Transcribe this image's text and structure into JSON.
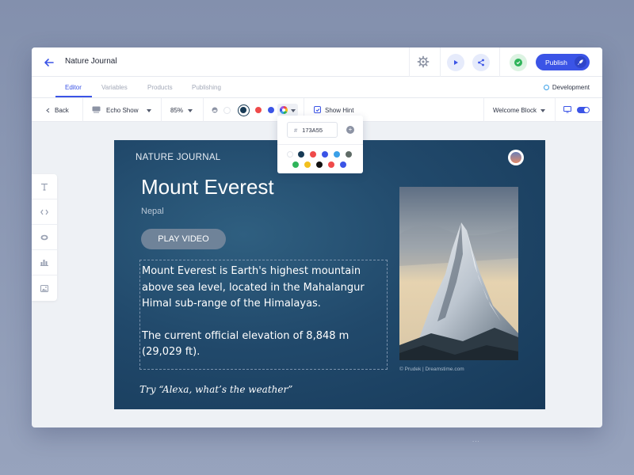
{
  "app": {
    "title": "Nature Journal"
  },
  "topbar": {
    "publish_label": "Publish"
  },
  "tabs": [
    {
      "label": "Editor",
      "active": true
    },
    {
      "label": "Variables",
      "active": false
    },
    {
      "label": "Products",
      "active": false
    },
    {
      "label": "Publishing",
      "active": false
    }
  ],
  "environment": {
    "label": "Development"
  },
  "toolbar": {
    "back_label": "Back",
    "device": "Echo Show",
    "zoom": "85%",
    "show_hint_label": "Show Hint",
    "show_hint_checked": true,
    "block": "Welcome Block",
    "toolbar_swatches": [
      "#ffffff",
      "#173A55",
      "#ef4a4a",
      "#3b54e6"
    ]
  },
  "color_picker": {
    "hex_value": "173A55",
    "swatches": [
      "#ffffff",
      "#173A55",
      "#ef4a4a",
      "#3b54e6",
      "#3aa0e8",
      "#5f6b66",
      "#2fb45a",
      "#f2c01e",
      "#111111",
      "#ef4a4a",
      "#3b54e6"
    ]
  },
  "card": {
    "header": "NATURE JOURNAL",
    "title": "Mount Everest",
    "subtitle": "Nepal",
    "button_label": "PLAY VIDEO",
    "body_p1": "Mount Everest is Earth's highest mountain above sea level, located in the Mahalangur Himal sub-range of the Himalayas.",
    "body_p2": "The current official elevation of 8,848 m (29,029 ft).",
    "hint": "Try “Alexa, what’s the weather”",
    "photo_credit": "© Prudek | Dreamstime.com",
    "background_color": "#173A55"
  },
  "rail_tools": [
    "text-tool-icon",
    "code-tool-icon",
    "shape-tool-icon",
    "chart-tool-icon",
    "image-tool-icon"
  ],
  "colors": {
    "accent": "#3b54e6",
    "success": "#2fb45a",
    "canvas_bg": "#173A55"
  },
  "pager_text": "..."
}
